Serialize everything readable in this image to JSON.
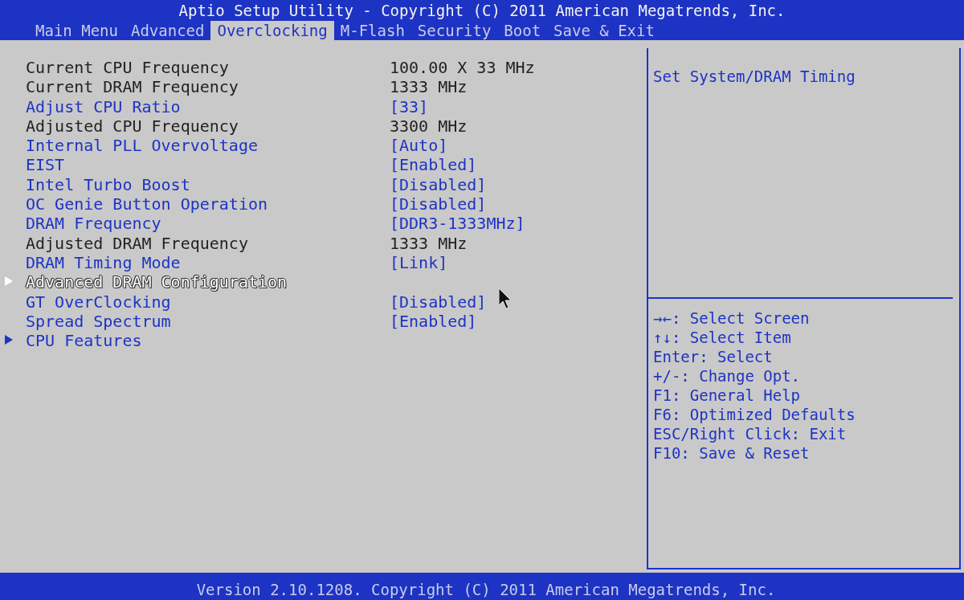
{
  "header": {
    "title": "Aptio Setup Utility - Copyright (C) 2011 American Megatrends, Inc."
  },
  "tabs": [
    {
      "label": "Main Menu",
      "selected": false
    },
    {
      "label": "Advanced",
      "selected": false
    },
    {
      "label": "Overclocking",
      "selected": true
    },
    {
      "label": "M-Flash",
      "selected": false
    },
    {
      "label": "Security",
      "selected": false
    },
    {
      "label": "Boot",
      "selected": false
    },
    {
      "label": "Save & Exit",
      "selected": false
    }
  ],
  "items": [
    {
      "kind": "info",
      "label": "Current CPU Frequency",
      "value": "100.00 X 33 MHz",
      "selected": false
    },
    {
      "kind": "info",
      "label": "Current DRAM Frequency",
      "value": "1333 MHz",
      "selected": false
    },
    {
      "kind": "option",
      "label": "Adjust CPU Ratio",
      "value": "[33]",
      "selected": false
    },
    {
      "kind": "info",
      "label": "Adjusted CPU Frequency",
      "value": "3300 MHz",
      "selected": false
    },
    {
      "kind": "option",
      "label": "Internal PLL Overvoltage",
      "value": "[Auto]",
      "selected": false
    },
    {
      "kind": "option",
      "label": "EIST",
      "value": "[Enabled]",
      "selected": false
    },
    {
      "kind": "option",
      "label": "Intel Turbo Boost",
      "value": "[Disabled]",
      "selected": false
    },
    {
      "kind": "option",
      "label": "OC Genie Button Operation",
      "value": "[Disabled]",
      "selected": false
    },
    {
      "kind": "option",
      "label": "DRAM Frequency",
      "value": "[DDR3-1333MHz]",
      "selected": false
    },
    {
      "kind": "info",
      "label": "Adjusted DRAM Frequency",
      "value": "1333 MHz",
      "selected": false
    },
    {
      "kind": "option",
      "label": "DRAM Timing Mode",
      "value": "[Link]",
      "selected": false
    },
    {
      "kind": "submenu",
      "label": "Advanced DRAM Configuration",
      "selected": true
    },
    {
      "kind": "option",
      "label": "GT OverClocking",
      "value": "[Disabled]",
      "selected": false
    },
    {
      "kind": "option",
      "label": "Spread Spectrum",
      "value": "[Enabled]",
      "selected": false
    },
    {
      "kind": "submenu",
      "label": "CPU Features",
      "selected": false
    }
  ],
  "help": {
    "description": "Set System/DRAM Timing",
    "keys": [
      "→←: Select Screen",
      "↑↓: Select Item",
      "Enter: Select",
      "+/-: Change Opt.",
      "F1: General Help",
      "F6: Optimized Defaults",
      "ESC/Right Click: Exit",
      "F10: Save & Reset"
    ]
  },
  "footer": {
    "text": "Version 2.10.1208. Copyright (C) 2011 American Megatrends, Inc."
  }
}
